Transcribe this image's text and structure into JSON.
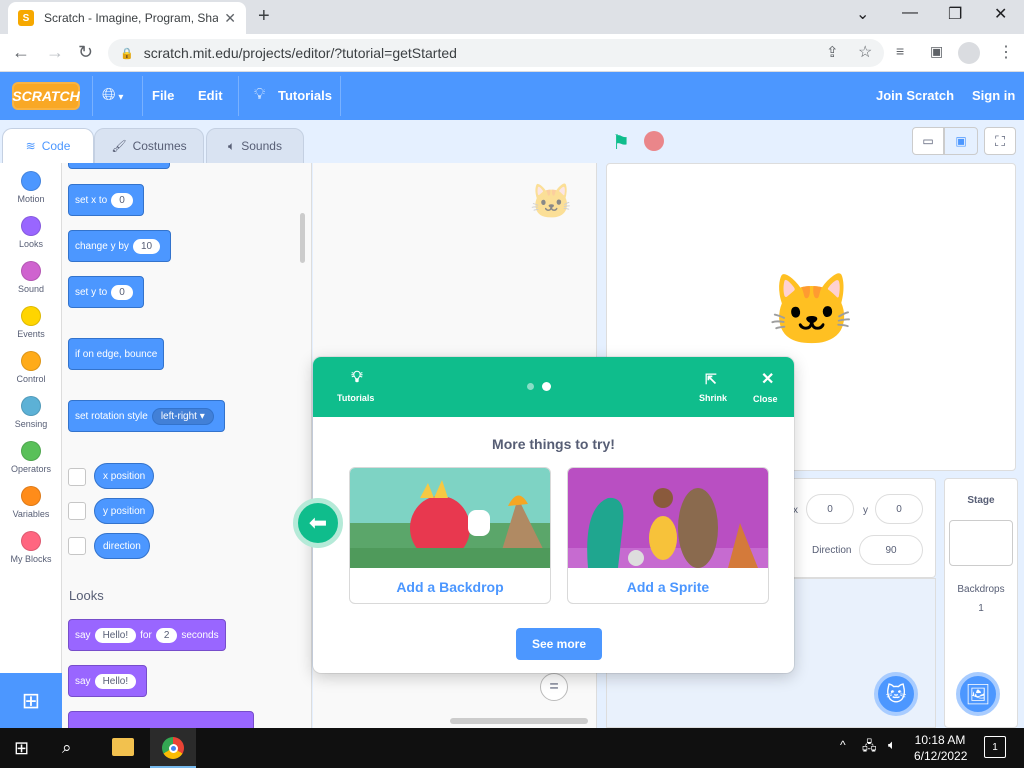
{
  "browser": {
    "tab_title": "Scratch - Imagine, Program, Sha",
    "url": "scratch.mit.edu/projects/editor/?tutorial=getStarted"
  },
  "menubar": {
    "logo": "SCRATCH",
    "file": "File",
    "edit": "Edit",
    "tutorials": "Tutorials",
    "join": "Join Scratch",
    "signin": "Sign in"
  },
  "editor_tabs": {
    "code": "Code",
    "costumes": "Costumes",
    "sounds": "Sounds"
  },
  "categories": [
    {
      "label": "Motion",
      "color": "#4c97ff"
    },
    {
      "label": "Looks",
      "color": "#9966ff"
    },
    {
      "label": "Sound",
      "color": "#cf63cf"
    },
    {
      "label": "Events",
      "color": "#ffd500"
    },
    {
      "label": "Control",
      "color": "#ffab19"
    },
    {
      "label": "Sensing",
      "color": "#5cb1d6"
    },
    {
      "label": "Operators",
      "color": "#59c059"
    },
    {
      "label": "Variables",
      "color": "#ff8c1a"
    },
    {
      "label": "My Blocks",
      "color": "#ff6680"
    }
  ],
  "blocks": {
    "set_x": {
      "label": "set x to",
      "value": "0"
    },
    "change_y": {
      "label": "change y by",
      "value": "10"
    },
    "set_y": {
      "label": "set y to",
      "value": "0"
    },
    "bounce": "if on edge, bounce",
    "rotation": {
      "label": "set rotation style",
      "value": "left-right"
    },
    "x_position": "x position",
    "y_position": "y position",
    "direction": "direction",
    "looks_heading": "Looks",
    "say_for": {
      "say": "say",
      "value": "Hello!",
      "for": "for",
      "secs": "2",
      "seconds": "seconds"
    },
    "say": {
      "say": "say",
      "value": "Hello!"
    }
  },
  "sprite_info": {
    "x_value": "0",
    "y_label": "y",
    "y_value": "0",
    "direction_label": "Direction",
    "direction_value": "90"
  },
  "stage_panel": {
    "title": "Stage",
    "backdrops_label": "Backdrops",
    "backdrops_count": "1"
  },
  "tutorial_modal": {
    "tutorials_label": "Tutorials",
    "shrink_label": "Shrink",
    "close_label": "Close",
    "heading": "More things to try!",
    "card1": "Add a Backdrop",
    "card2": "Add a Sprite",
    "see_more": "See more"
  },
  "zoom_reset": "=",
  "taskbar": {
    "time": "10:18 AM",
    "date": "6/12/2022",
    "notifications": "1"
  }
}
